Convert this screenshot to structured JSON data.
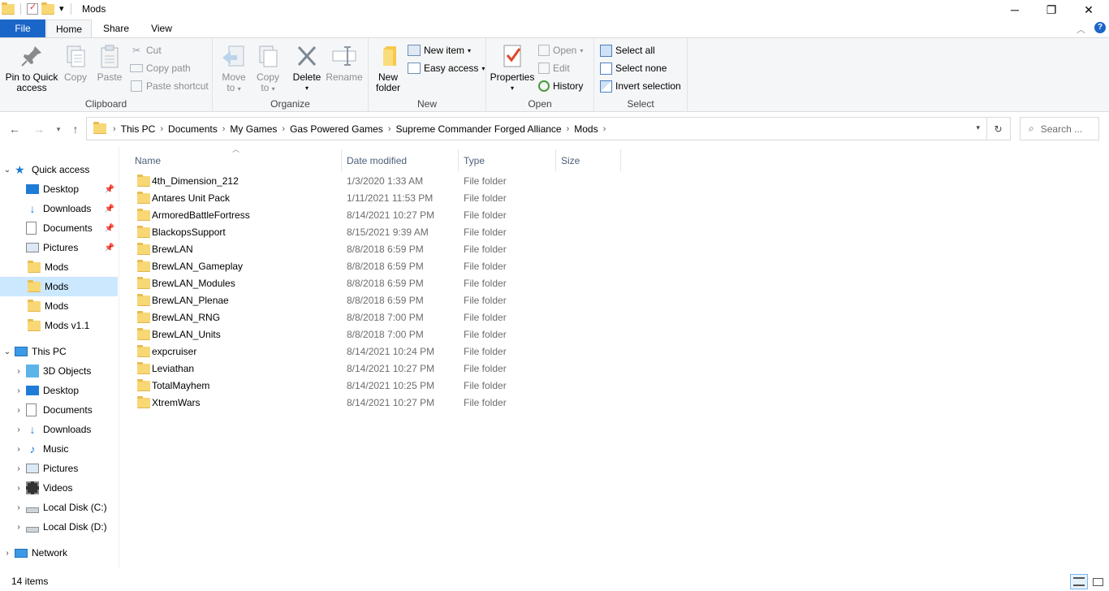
{
  "window": {
    "title": "Mods",
    "minimize_glyph": "─",
    "maximize_glyph": "❐",
    "close_glyph": "✕",
    "qat_dropdown_glyph": "▾"
  },
  "tabs": [
    "File",
    "Home",
    "Share",
    "View"
  ],
  "ribbon": {
    "clipboard": {
      "title": "Clipboard",
      "pin_label_1": "Pin to Quick",
      "pin_label_2": "access",
      "copy_label": "Copy",
      "paste_label": "Paste",
      "cut_label": "Cut",
      "copy_path_label": "Copy path",
      "paste_shortcut_label": "Paste shortcut"
    },
    "organize": {
      "title": "Organize",
      "move_to_1": "Move",
      "move_to_2": "to",
      "copy_to_1": "Copy",
      "copy_to_2": "to",
      "delete_label": "Delete",
      "rename_label": "Rename"
    },
    "new": {
      "title": "New",
      "new_folder_1": "New",
      "new_folder_2": "folder",
      "new_item_label": "New item",
      "easy_access_label": "Easy access"
    },
    "open": {
      "title": "Open",
      "properties_label": "Properties",
      "open_label": "Open",
      "edit_label": "Edit",
      "history_label": "History"
    },
    "select": {
      "title": "Select",
      "select_all_label": "Select all",
      "select_none_label": "Select none",
      "invert_label": "Invert selection"
    }
  },
  "address": {
    "crumbs": [
      "This PC",
      "Documents",
      "My Games",
      "Gas Powered Games",
      "Supreme Commander Forged Alliance",
      "Mods"
    ],
    "search_placeholder": "Search ..."
  },
  "nav": {
    "quick_access_label": "Quick access",
    "quick_items": [
      "Desktop",
      "Downloads",
      "Documents",
      "Pictures",
      "Mods",
      "Mods",
      "Mods",
      "Mods v1.1"
    ],
    "this_pc_label": "This PC",
    "pc_items": [
      "3D Objects",
      "Desktop",
      "Documents",
      "Downloads",
      "Music",
      "Pictures",
      "Videos",
      "Local Disk (C:)",
      "Local Disk (D:)"
    ],
    "network_label": "Network"
  },
  "columns": {
    "name": "Name",
    "date": "Date modified",
    "type": "Type",
    "size": "Size"
  },
  "files": [
    {
      "name": "4th_Dimension_212",
      "date": "1/3/2020 1:33 AM",
      "type": "File folder"
    },
    {
      "name": "Antares Unit Pack",
      "date": "1/11/2021 11:53 PM",
      "type": "File folder"
    },
    {
      "name": "ArmoredBattleFortress",
      "date": "8/14/2021 10:27 PM",
      "type": "File folder"
    },
    {
      "name": "BlackopsSupport",
      "date": "8/15/2021 9:39 AM",
      "type": "File folder"
    },
    {
      "name": "BrewLAN",
      "date": "8/8/2018 6:59 PM",
      "type": "File folder"
    },
    {
      "name": "BrewLAN_Gameplay",
      "date": "8/8/2018 6:59 PM",
      "type": "File folder"
    },
    {
      "name": "BrewLAN_Modules",
      "date": "8/8/2018 6:59 PM",
      "type": "File folder"
    },
    {
      "name": "BrewLAN_Plenae",
      "date": "8/8/2018 6:59 PM",
      "type": "File folder"
    },
    {
      "name": "BrewLAN_RNG",
      "date": "8/8/2018 7:00 PM",
      "type": "File folder"
    },
    {
      "name": "BrewLAN_Units",
      "date": "8/8/2018 7:00 PM",
      "type": "File folder"
    },
    {
      "name": "expcruiser",
      "date": "8/14/2021 10:24 PM",
      "type": "File folder"
    },
    {
      "name": "Leviathan",
      "date": "8/14/2021 10:27 PM",
      "type": "File folder"
    },
    {
      "name": "TotalMayhem",
      "date": "8/14/2021 10:25 PM",
      "type": "File folder"
    },
    {
      "name": "XtremWars",
      "date": "8/14/2021 10:27 PM",
      "type": "File folder"
    }
  ],
  "status": {
    "item_count": "14 items"
  },
  "colors": {
    "file_tab": "#1a66c8",
    "selection": "#cce8ff",
    "folder": "#f8d775"
  }
}
